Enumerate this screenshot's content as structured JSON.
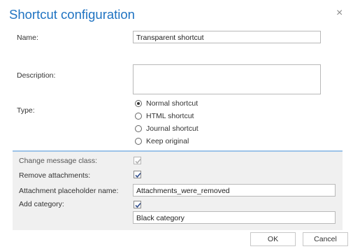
{
  "dialog": {
    "title": "Shortcut configuration",
    "close_label": "×"
  },
  "form": {
    "name_label": "Name:",
    "name_value": "Transparent shortcut",
    "description_label": "Description:",
    "description_value": "",
    "type_label": "Type:",
    "type_options": [
      {
        "label": "Normal shortcut",
        "selected": true
      },
      {
        "label": "HTML shortcut",
        "selected": false
      },
      {
        "label": "Journal shortcut",
        "selected": false
      },
      {
        "label": "Keep original",
        "selected": false
      }
    ]
  },
  "advanced": {
    "change_message_class_label": "Change message class:",
    "change_message_class_checked": true,
    "remove_attachments_label": "Remove attachments:",
    "remove_attachments_checked": true,
    "placeholder_name_label": "Attachment placeholder name:",
    "placeholder_name_value": "Attachments_were_removed",
    "add_category_label": "Add category:",
    "add_category_checked": true,
    "category_value": "Black category"
  },
  "buttons": {
    "ok": "OK",
    "cancel": "Cancel"
  },
  "colors": {
    "title": "#1f73c2",
    "section_border": "#9cc3e8",
    "section_bg": "#f0f0f0"
  }
}
